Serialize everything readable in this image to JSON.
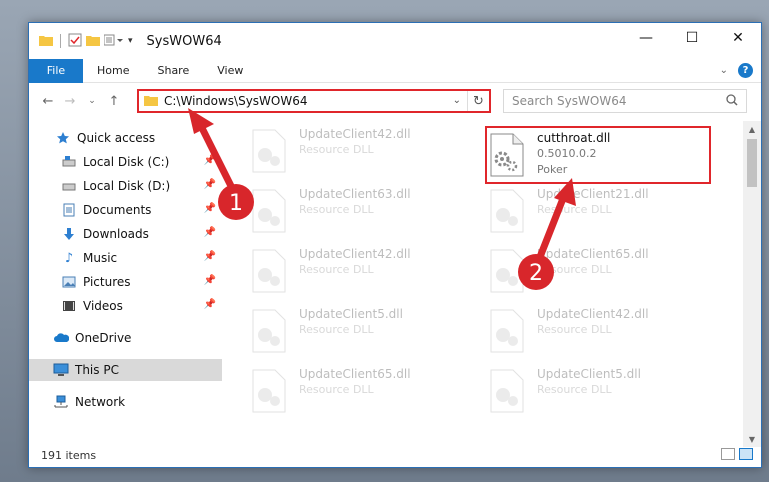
{
  "window": {
    "title": "SysWOW64"
  },
  "ribbon": {
    "tabs": [
      "File",
      "Home",
      "Share",
      "View"
    ],
    "help": "?"
  },
  "address": {
    "path": "C:\\Windows\\SysWOW64"
  },
  "search": {
    "placeholder": "Search SysWOW64"
  },
  "nav": {
    "items": [
      {
        "label": "Quick access",
        "icon": "star-icon",
        "pinned": false
      },
      {
        "label": "Local Disk (C:)",
        "icon": "drive-icon",
        "pinned": true
      },
      {
        "label": "Local Disk (D:)",
        "icon": "drive-icon",
        "pinned": true
      },
      {
        "label": "Documents",
        "icon": "documents-icon",
        "pinned": true
      },
      {
        "label": "Downloads",
        "icon": "download-icon",
        "pinned": true
      },
      {
        "label": "Music",
        "icon": "music-icon",
        "pinned": true
      },
      {
        "label": "Pictures",
        "icon": "pictures-icon",
        "pinned": true
      },
      {
        "label": "Videos",
        "icon": "videos-icon",
        "pinned": true
      },
      {
        "label": "OneDrive",
        "icon": "cloud-icon",
        "pinned": false
      },
      {
        "label": "This PC",
        "icon": "computer-icon",
        "pinned": false
      },
      {
        "label": "Network",
        "icon": "network-icon",
        "pinned": false
      }
    ]
  },
  "files": {
    "left": [
      {
        "name": "UpdateClient42.dll",
        "type": "Resource DLL"
      },
      {
        "name": "UpdateClient63.dll",
        "type": "Resource DLL"
      },
      {
        "name": "UpdateClient42.dll",
        "type": "Resource DLL"
      },
      {
        "name": "UpdateClient5.dll",
        "type": "Resource DLL"
      },
      {
        "name": "UpdateClient65.dll",
        "type": "Resource DLL"
      }
    ],
    "right": [
      {
        "name": "cutthroat.dll",
        "version": "0.5010.0.2",
        "type": "Poker"
      },
      {
        "name": "UpdateClient21.dll",
        "type": "Resource DLL"
      },
      {
        "name": "UpdateClient65.dll",
        "type": "Resource DLL"
      },
      {
        "name": "UpdateClient42.dll",
        "type": "Resource DLL"
      },
      {
        "name": "UpdateClient5.dll",
        "type": "Resource DLL"
      }
    ]
  },
  "status": {
    "count": "191 items"
  },
  "annotations": {
    "step1": "1",
    "step2": "2"
  },
  "colors": {
    "accent": "#1979ca",
    "highlight": "#e0262b"
  }
}
